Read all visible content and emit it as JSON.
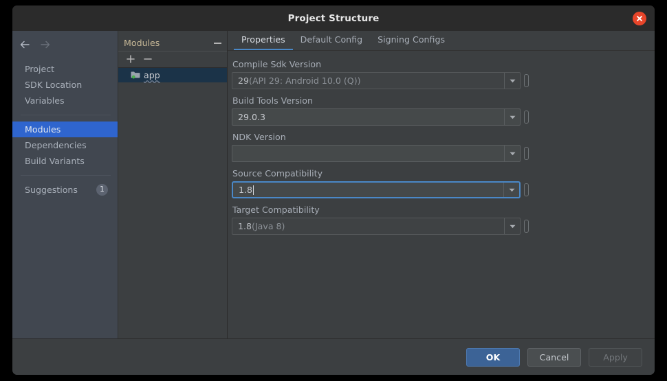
{
  "window": {
    "title": "Project Structure",
    "close_icon": "close-icon"
  },
  "leftnav": {
    "back_icon": "arrow-left-icon",
    "forward_icon": "arrow-right-icon",
    "group_one": [
      {
        "label": "Project"
      },
      {
        "label": "SDK Location"
      },
      {
        "label": "Variables"
      }
    ],
    "group_two": [
      {
        "label": "Modules",
        "selected": true
      },
      {
        "label": "Dependencies",
        "selected": false
      },
      {
        "label": "Build Variants",
        "selected": false
      }
    ],
    "group_three": [
      {
        "label": "Suggestions",
        "badge": "1"
      }
    ]
  },
  "modules_panel": {
    "title": "Modules",
    "collapse_icon": "minus-icon",
    "add_icon": "plus-icon",
    "remove_icon": "minus-icon",
    "items": [
      {
        "label": "app",
        "icon": "module-folder-icon",
        "selected": true
      }
    ]
  },
  "tabs": [
    {
      "label": "Properties",
      "active": true
    },
    {
      "label": "Default Config",
      "active": false
    },
    {
      "label": "Signing Configs",
      "active": false
    }
  ],
  "fields": [
    {
      "label": "Compile Sdk Version",
      "value_strong": "29",
      "value_muted": " (API 29: Android 10.0 (Q))",
      "state": "disabled",
      "name": "compile-sdk-version"
    },
    {
      "label": "Build Tools Version",
      "value_strong": "29.0.3",
      "value_muted": "",
      "state": "normal",
      "name": "build-tools-version"
    },
    {
      "label": "NDK Version",
      "value_strong": "",
      "value_muted": "",
      "state": "normal",
      "name": "ndk-version"
    },
    {
      "label": "Source Compatibility",
      "value_strong": "1.8",
      "value_muted": "",
      "state": "focused",
      "name": "source-compatibility"
    },
    {
      "label": "Target Compatibility",
      "value_strong": "1.8",
      "value_muted": " (Java 8)",
      "state": "disabled",
      "name": "target-compatibility"
    }
  ],
  "footer": {
    "ok_label": "OK",
    "cancel_label": "Cancel",
    "apply_label": "Apply"
  },
  "colors": {
    "accent_blue": "#2f65ce",
    "tab_underline": "#4a88c7",
    "close_red": "#e8452a",
    "module_selected": "#1b3348",
    "primary_button": "#3c6396",
    "modules_title": "#c8b998",
    "module_dot_green": "#4caf50"
  }
}
